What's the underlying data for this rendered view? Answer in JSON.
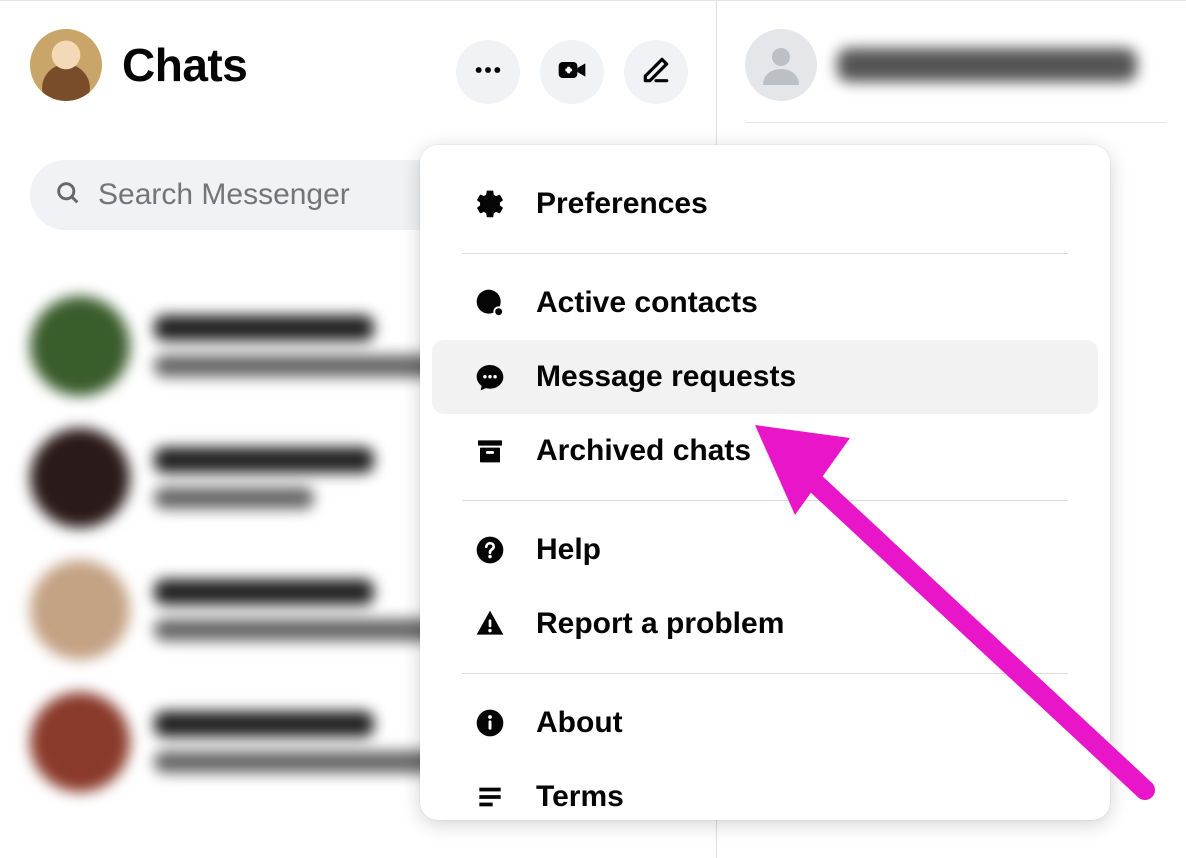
{
  "header": {
    "title": "Chats"
  },
  "search": {
    "placeholder": "Search Messenger"
  },
  "menu": {
    "preferences": "Preferences",
    "active_contacts": "Active contacts",
    "message_requests": "Message requests",
    "archived_chats": "Archived chats",
    "help": "Help",
    "report": "Report a problem",
    "about": "About",
    "terms": "Terms"
  }
}
